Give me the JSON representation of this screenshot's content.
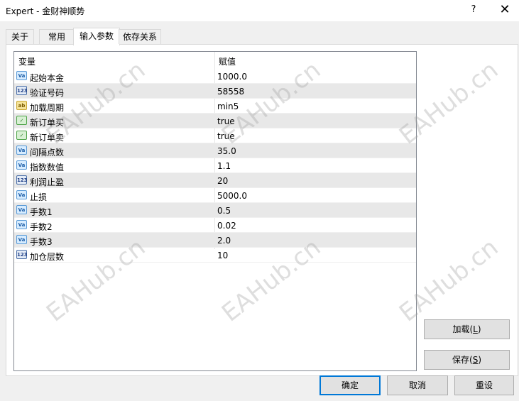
{
  "window": {
    "title": "Expert - 金财神顺势",
    "help_label": "?",
    "close_label": "✕"
  },
  "tabs": [
    {
      "label": "关于"
    },
    {
      "label": "常用"
    },
    {
      "label": "输入参数"
    },
    {
      "label": "依存关系"
    }
  ],
  "active_tab": "输入参数",
  "grid": {
    "columns": [
      "变量",
      "赋值"
    ],
    "rows": [
      {
        "name": "起始本金",
        "value": "1000.0",
        "type_icon": "double-icon"
      },
      {
        "name": "验证号码",
        "value": "58558",
        "type_icon": "int-icon"
      },
      {
        "name": "加载周期",
        "value": "min5",
        "type_icon": "string-icon"
      },
      {
        "name": "新订单买",
        "value": "true",
        "type_icon": "bool-icon"
      },
      {
        "name": "新订单卖",
        "value": "true",
        "type_icon": "bool-icon"
      },
      {
        "name": "间隔点数",
        "value": "35.0",
        "type_icon": "double-icon"
      },
      {
        "name": "指数数值",
        "value": "1.1",
        "type_icon": "double-icon"
      },
      {
        "name": "利润止盈",
        "value": "20",
        "type_icon": "int-icon"
      },
      {
        "name": "止损",
        "value": "5000.0",
        "type_icon": "double-icon"
      },
      {
        "name": "手数1",
        "value": "0.5",
        "type_icon": "double-icon"
      },
      {
        "name": "手数2",
        "value": "0.02",
        "type_icon": "double-icon"
      },
      {
        "name": "手数3",
        "value": "2.0",
        "type_icon": "double-icon"
      },
      {
        "name": "加仓层数",
        "value": "10",
        "type_icon": "int-icon"
      }
    ]
  },
  "icon_glyphs": {
    "double": "Va",
    "int": "123",
    "string": "ab",
    "bool": "✓"
  },
  "side_buttons": {
    "load_label": "加载",
    "load_key": "L",
    "save_label": "保存",
    "save_key": "S"
  },
  "footer_buttons": {
    "ok_label": "确定",
    "cancel_label": "取消",
    "reset_label": "重设"
  },
  "watermark": "EAHub.cn"
}
